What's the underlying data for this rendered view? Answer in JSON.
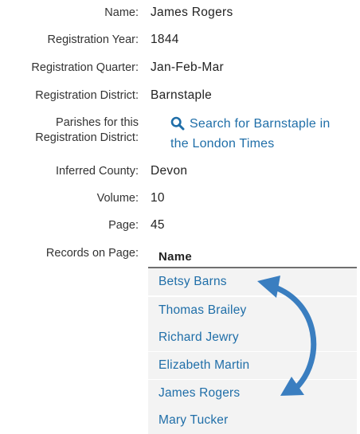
{
  "fields": {
    "name_label": "Name:",
    "name_value": "James Rogers",
    "year_label": "Registration Year:",
    "year_value": "1844",
    "quarter_label": "Registration Quarter:",
    "quarter_value": "Jan-Feb-Mar",
    "district_label": "Registration District:",
    "district_value": "Barnstaple",
    "parishes_label_line1": "Parishes for this",
    "parishes_label_line2": "Registration District:",
    "search_link_line1": "Search for Barnstaple in",
    "search_link_line2": "the London Times",
    "county_label": "Inferred County:",
    "county_value": "Devon",
    "volume_label": "Volume:",
    "volume_value": "10",
    "page_label": "Page:",
    "page_value": "45",
    "records_label": "Records on Page:"
  },
  "records": {
    "header": "Name",
    "rows": [
      "Betsy Barns",
      "Thomas Brailey",
      "Richard Jewry",
      "Elizabeth Martin",
      "James Rogers",
      "Mary Tucker"
    ]
  },
  "icons": {
    "search": "search-icon",
    "annotation_arrow": "double-headed-curved-arrow"
  },
  "colors": {
    "link": "#1f6ea8",
    "arrow": "#3a7ec0",
    "row_bg": "#f3f3f3"
  }
}
